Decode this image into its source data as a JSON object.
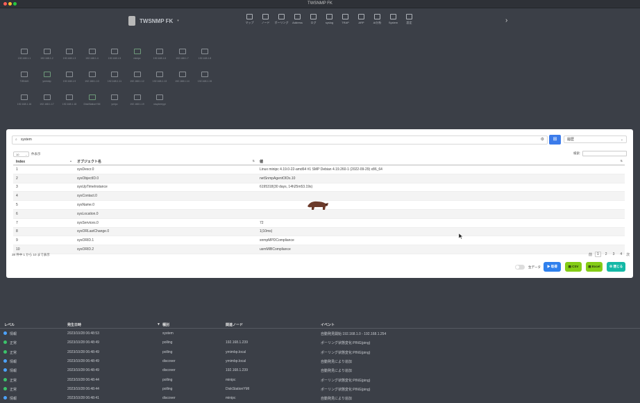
{
  "window": {
    "title": "TWSNMP FK"
  },
  "brand": {
    "name": "TWSNMP FK"
  },
  "nav": [
    {
      "label": "マップ",
      "icon": "map-icon"
    },
    {
      "label": "ノード",
      "icon": "node-icon"
    },
    {
      "label": "ポーリング",
      "icon": "polling-icon"
    },
    {
      "label": "Address",
      "icon": "address-icon"
    },
    {
      "label": "ログ",
      "icon": "log-icon"
    },
    {
      "label": "syslog",
      "icon": "syslog-icon"
    },
    {
      "label": "TRAP",
      "icon": "trap-icon"
    },
    {
      "label": "ARP",
      "icon": "arp-icon"
    },
    {
      "label": "AI分析",
      "icon": "ai-icon"
    },
    {
      "label": "System",
      "icon": "system-icon"
    },
    {
      "label": "設定",
      "icon": "settings-icon"
    }
  ],
  "map_nodes": [
    {
      "label": "192.168.1.1"
    },
    {
      "label": "192.168.1.2"
    },
    {
      "label": "192.168.1.3"
    },
    {
      "label": "192.168.1.4"
    },
    {
      "label": "192.168.1.5"
    },
    {
      "label": "minipc"
    },
    {
      "label": "192.168.1.6"
    },
    {
      "label": "192.168.1.7"
    },
    {
      "label": "192.168.1.8"
    },
    {
      "label": "TWNAS"
    },
    {
      "label": "ymimbp"
    },
    {
      "label": "192.168.1.9"
    },
    {
      "label": "192.168.1.10"
    },
    {
      "label": "192.168.1.11"
    },
    {
      "label": "192.168.1.12"
    },
    {
      "label": "192.168.1.13"
    },
    {
      "label": "192.168.1.14"
    },
    {
      "label": "192.168.1.15"
    },
    {
      "label": "192.168.1.16"
    },
    {
      "label": "192.168.1.17"
    },
    {
      "label": "192.168.1.18"
    },
    {
      "label": "DiskStationYMI"
    },
    {
      "label": "ymipc"
    },
    {
      "label": "192.168.1.19"
    },
    {
      "label": "raspberrypi"
    }
  ],
  "modal": {
    "search": {
      "value": "system"
    },
    "mode_select": "履歴",
    "length": {
      "value": "10",
      "suffix": "件表示"
    },
    "filter_label": "検索:",
    "columns": [
      "Index",
      "オブジェクト名",
      "値"
    ],
    "rows": [
      {
        "index": "1",
        "name": "sysDescr.0",
        "value": "Linux minipc 4.19.0-22-amd64 #1 SMP Debian 4.19.260-1 (2022-09-29) x86_64"
      },
      {
        "index": "2",
        "name": "sysObjectID.0",
        "value": "netSnmpAgentOIDs.10"
      },
      {
        "index": "3",
        "name": "sysUpTimeInstance",
        "value": "6195318(30 days, 14h25m53.19s)"
      },
      {
        "index": "4",
        "name": "sysContact.0",
        "value": ""
      },
      {
        "index": "5",
        "name": "sysName.0",
        "value": ""
      },
      {
        "index": "6",
        "name": "sysLocation.0",
        "value": ""
      },
      {
        "index": "7",
        "name": "sysServices.0",
        "value": "72"
      },
      {
        "index": "8",
        "name": "sysORLastChange.0",
        "value": "1(10ms)"
      },
      {
        "index": "9",
        "name": "sysORID.1",
        "value": "snmpMPDCompliance"
      },
      {
        "index": "10",
        "name": "sysORID.2",
        "value": "usmMIBCompliance"
      }
    ],
    "info": "38 件中 1 から 10 まで表示",
    "pager": {
      "prev": "前",
      "pages": [
        "1",
        "2",
        "3",
        "4"
      ],
      "next": "次",
      "active": "1"
    },
    "toggle_label": "生データ",
    "buttons": {
      "search": "取得",
      "csv": "CSV",
      "excel": "Excel",
      "close": "閉じる"
    }
  },
  "log": {
    "columns": [
      "レベル",
      "発生日時",
      "種別",
      "関連ノード",
      "イベント"
    ],
    "rows": [
      {
        "level": "情報",
        "kind": "info",
        "time": "2023/10/28 06:48:53",
        "type": "system",
        "node": "",
        "event": "自動発見開始 192.168.1.0 - 192.168.1.254"
      },
      {
        "level": "正常",
        "kind": "normal",
        "time": "2023/10/28 06:48:49",
        "type": "polling",
        "node": "192.168.1.239",
        "event": "ポーリング状態変化:PING(ping)"
      },
      {
        "level": "正常",
        "kind": "normal",
        "time": "2023/10/28 06:48:49",
        "type": "polling",
        "node": "ymimbp.local",
        "event": "ポーリング状態変化:PING(ping)"
      },
      {
        "level": "情報",
        "kind": "info",
        "time": "2023/10/28 06:48:49",
        "type": "discover",
        "node": "ymimbp.local",
        "event": "自動発見により追加"
      },
      {
        "level": "情報",
        "kind": "info",
        "time": "2023/10/28 06:48:49",
        "type": "discover",
        "node": "192.168.1.239",
        "event": "自動発見により追加"
      },
      {
        "level": "正常",
        "kind": "normal",
        "time": "2023/10/28 06:48:44",
        "type": "polling",
        "node": "minipc",
        "event": "ポーリング状態変化:PING(ping)"
      },
      {
        "level": "正常",
        "kind": "normal",
        "time": "2023/10/28 06:48:44",
        "type": "polling",
        "node": "DiskStationYMI",
        "event": "ポーリング状態変化:PING(ping)"
      },
      {
        "level": "情報",
        "kind": "info",
        "time": "2023/10/28 06:48:41",
        "type": "discover",
        "node": "minipc",
        "event": "自動発見により追加"
      }
    ]
  }
}
